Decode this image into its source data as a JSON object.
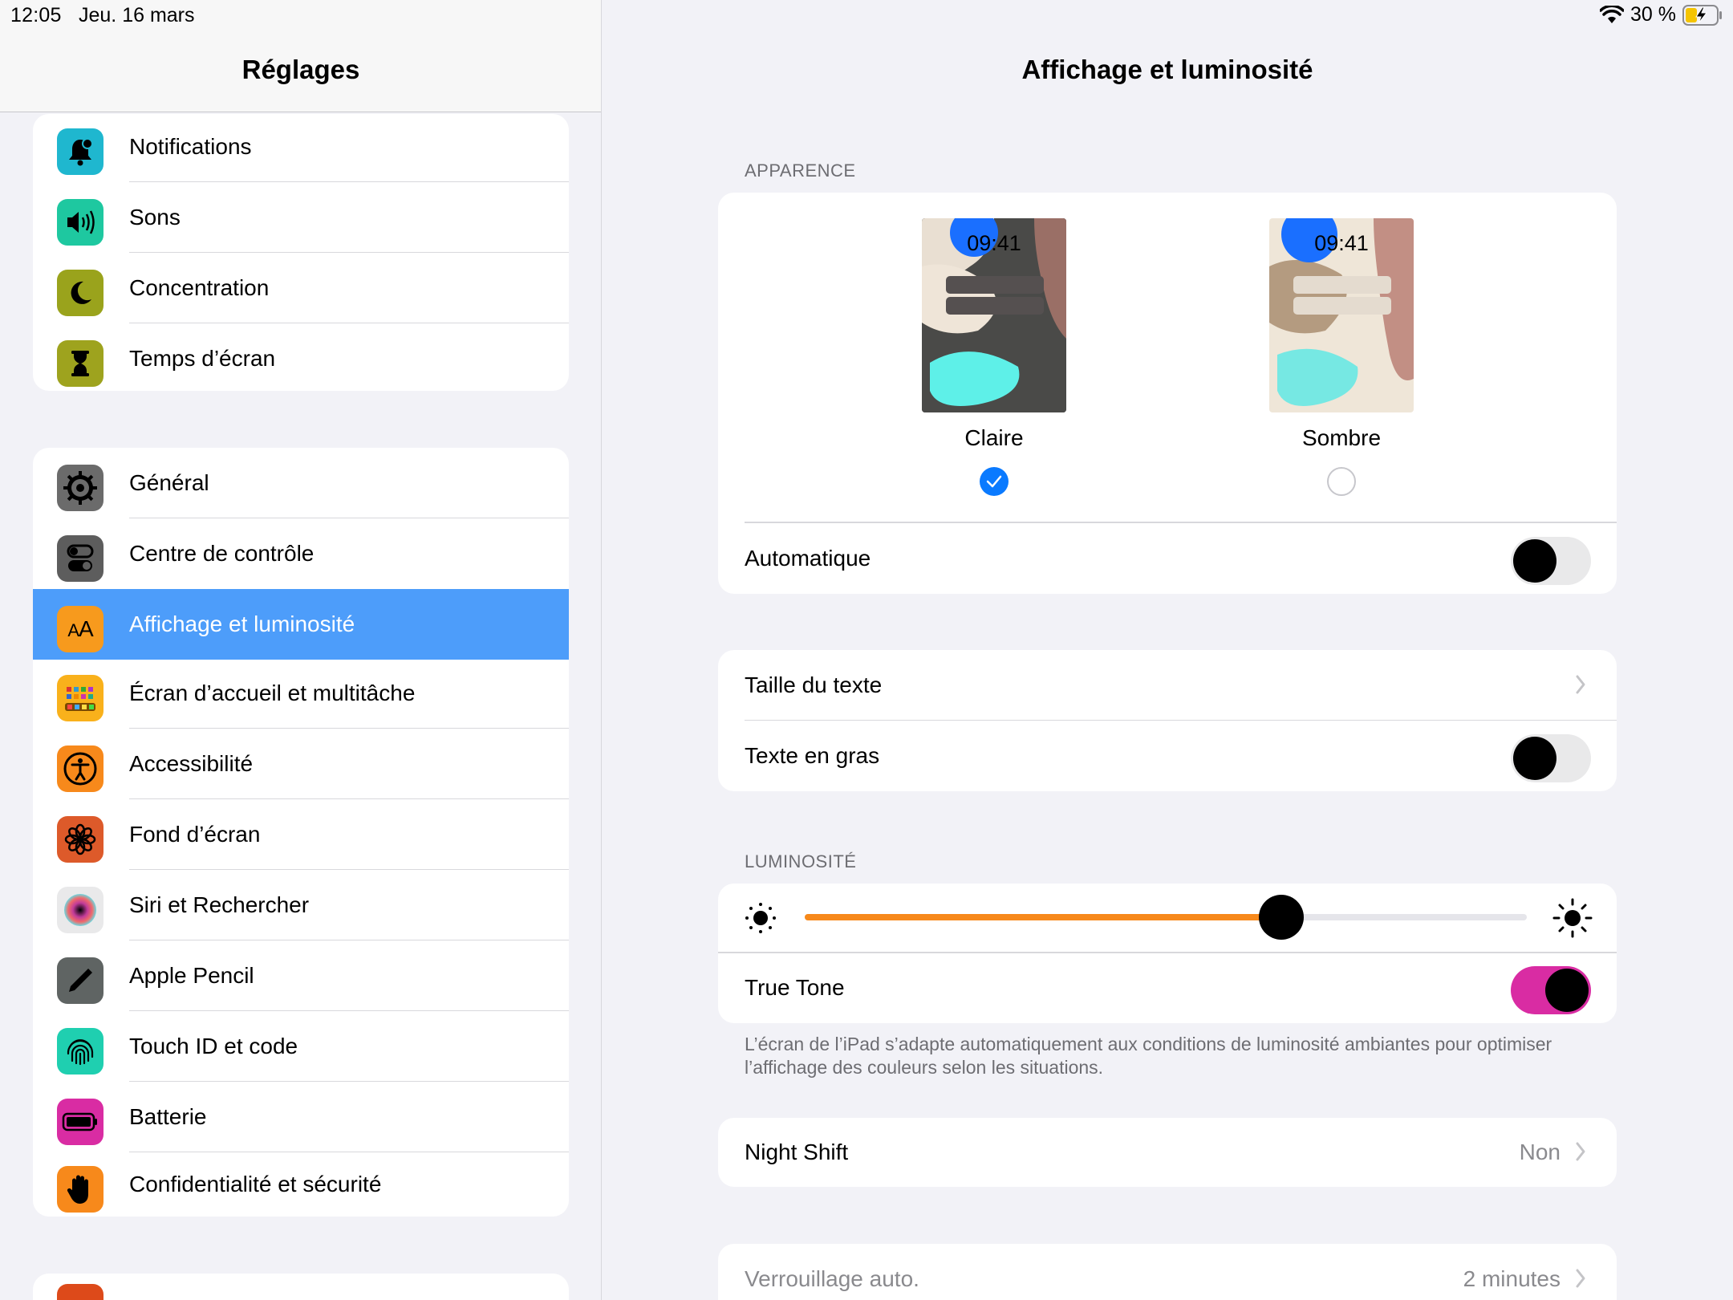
{
  "status": {
    "time": "12:05",
    "date": "Jeu. 16 mars",
    "battery": "30 %"
  },
  "sidebar": {
    "title": "Réglages",
    "group1": [
      {
        "label": "Notifications",
        "icon": "bell-icon",
        "color": "#1fb7cf"
      },
      {
        "label": "Sons",
        "icon": "speaker-icon",
        "color": "#1ec8a0"
      },
      {
        "label": "Concentration",
        "icon": "moon-icon",
        "color": "#9aa31c"
      },
      {
        "label": "Temps d’écran",
        "icon": "hourglass-icon",
        "color": "#9ea31e"
      }
    ],
    "group2": [
      {
        "label": "Général",
        "icon": "gear-icon",
        "color": "#6b6b6b"
      },
      {
        "label": "Centre de contrôle",
        "icon": "switches-icon",
        "color": "#5d5d5d"
      },
      {
        "label": "Affichage et luminosité",
        "icon": "text-size-icon",
        "color": "#f79a1d",
        "selected": true
      },
      {
        "label": "Écran d’accueil et multitâche",
        "icon": "home-grid-icon",
        "color": "#f9b11b"
      },
      {
        "label": "Accessibilité",
        "icon": "accessibility-icon",
        "color": "#f7891b"
      },
      {
        "label": "Fond d’écran",
        "icon": "flower-icon",
        "color": "#dd5a2a"
      },
      {
        "label": "Siri et Rechercher",
        "icon": "siri-icon",
        "color": "#e9e9ea"
      },
      {
        "label": "Apple Pencil",
        "icon": "pencil-icon",
        "color": "#5f6463"
      },
      {
        "label": "Touch ID et code",
        "icon": "fingerprint-icon",
        "color": "#1fcfb0"
      },
      {
        "label": "Batterie",
        "icon": "battery-icon",
        "color": "#d92ca3"
      },
      {
        "label": "Confidentialité et sécurité",
        "icon": "hand-icon",
        "color": "#f7891b"
      }
    ]
  },
  "main": {
    "title": "Affichage et luminosité",
    "appearance": {
      "header": "APPARENCE",
      "light_label": "Claire",
      "dark_label": "Sombre",
      "thumb_time": "09:41",
      "auto_label": "Automatique",
      "auto_on": false,
      "selected": "Claire"
    },
    "text": {
      "size_label": "Taille du texte",
      "bold_label": "Texte en gras",
      "bold_on": false
    },
    "brightness": {
      "header": "LUMINOSITÉ",
      "level": 0.66,
      "true_tone_label": "True Tone",
      "true_tone_on": true,
      "note": "L’écran de l’iPad s’adapte automatiquement aux conditions de luminosité ambiantes pour optimiser l’affichage des couleurs selon les situations."
    },
    "night_shift": {
      "label": "Night Shift",
      "value": "Non"
    },
    "auto_lock": {
      "label": "Verrouillage auto.",
      "value": "2 minutes"
    }
  },
  "colors": {
    "accent_blue": "#0a7aff",
    "selection": "#4d9dfa",
    "slider_fill": "#f7891b",
    "true_tone_toggle": "#d92ca3"
  }
}
